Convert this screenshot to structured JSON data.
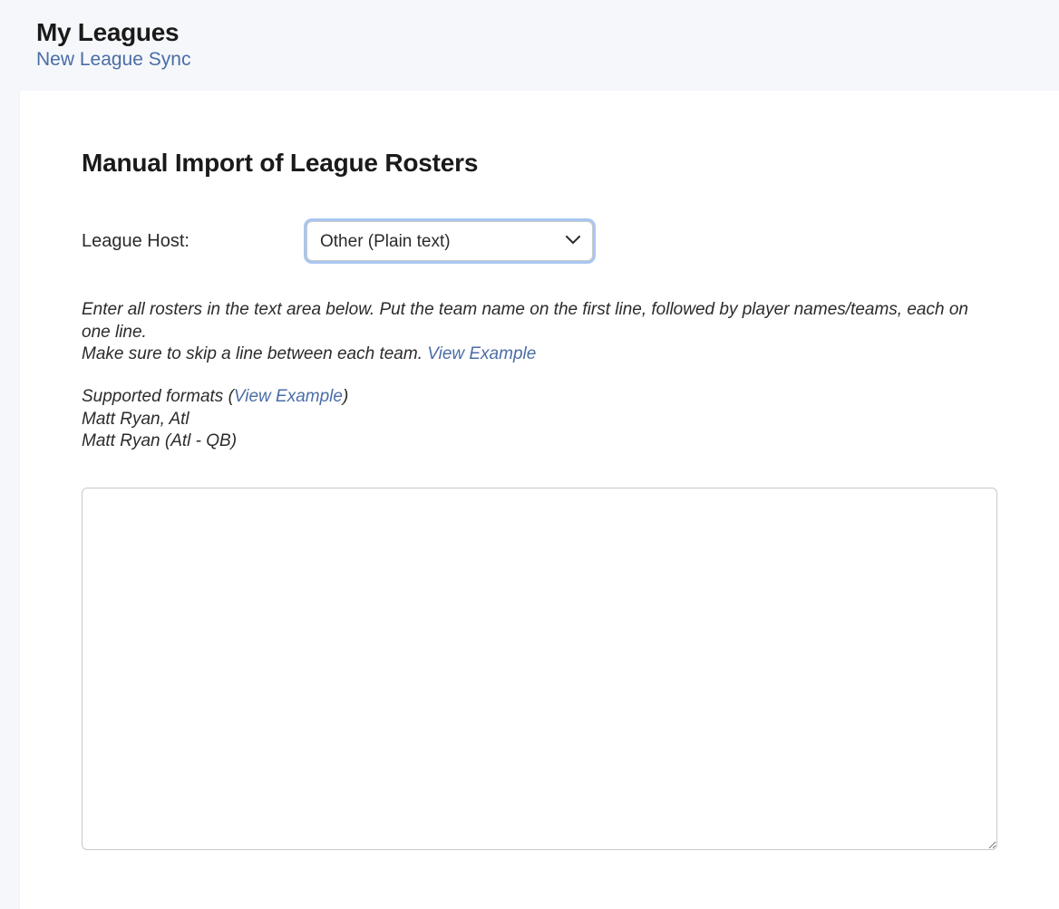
{
  "header": {
    "title": "My Leagues",
    "subtitle": "New League Sync"
  },
  "section": {
    "title": "Manual Import of League Rosters"
  },
  "form": {
    "league_host_label": "League Host:",
    "league_host_value": "Other (Plain text)"
  },
  "instructions": {
    "line1": "Enter all rosters in the text area below. Put the team name on the first line, followed by player names/teams, each on one line.",
    "line2": "Make sure to skip a line between each team. ",
    "view_example": "View Example"
  },
  "formats": {
    "label_prefix": "Supported formats (",
    "view_example": "View Example",
    "label_suffix": ")",
    "example1": "Matt Ryan, Atl",
    "example2": "Matt Ryan (Atl - QB)"
  },
  "textarea": {
    "value": ""
  }
}
